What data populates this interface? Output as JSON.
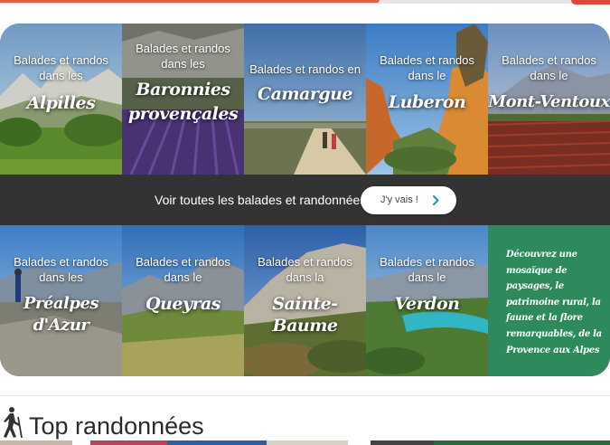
{
  "tiles_row1": [
    {
      "line1": "Balades et randos",
      "line2": "dans les",
      "name1": "Alpilles",
      "name2": ""
    },
    {
      "line1": "Balades et randos",
      "line2": "dans les",
      "name1": "Baronnies",
      "name2": "provençales"
    },
    {
      "line1": "Balades et randos en",
      "line2": "",
      "name1": "Camargue",
      "name2": ""
    },
    {
      "line1": "Balades et randos",
      "line2": "dans le",
      "name1": "Luberon",
      "name2": ""
    },
    {
      "line1": "Balades et randos",
      "line2": "dans le",
      "name1": "Mont-Ventoux",
      "name2": ""
    }
  ],
  "band": {
    "label": "Voir toutes les balades et randonnées",
    "button_label": "J'y vais !"
  },
  "tiles_row2": [
    {
      "line1": "Balades et randos",
      "line2": "dans les",
      "name1": "Préalpes d'Azur",
      "name2": ""
    },
    {
      "line1": "Balades et randos",
      "line2": "dans le",
      "name1": "Queyras",
      "name2": ""
    },
    {
      "line1": "Balades et randos",
      "line2": "dans la",
      "name1": "Sainte-Baume",
      "name2": ""
    },
    {
      "line1": "Balades et randos",
      "line2": "dans le",
      "name1": "Verdon",
      "name2": ""
    }
  ],
  "promo": {
    "text": "Découvrez une mosaïque de paysages, le patrimoine rural, la faune et la flore remarquables, de la Provence aux Alpes"
  },
  "section": {
    "title": "Top randonnées"
  },
  "colors": {
    "promo_green": "#2e8a5c",
    "band_dark": "#333333",
    "accent_red": "#e35d4f",
    "chevron_teal": "#2a8fa8"
  },
  "icons": {
    "hiker": "hiker-icon",
    "chevron": "chevron-right-icon"
  }
}
